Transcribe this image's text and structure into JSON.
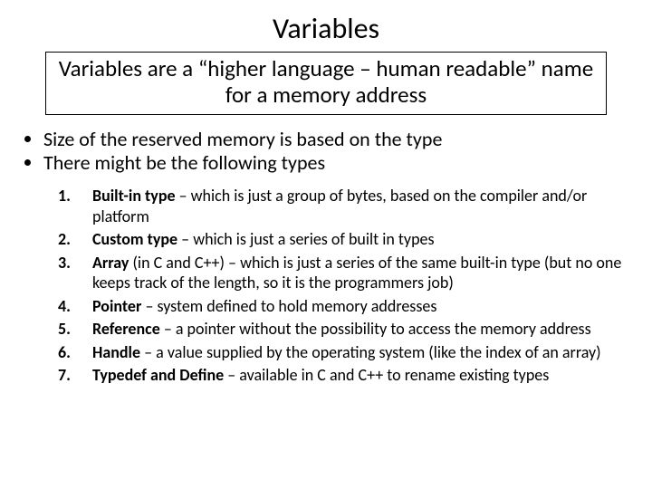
{
  "title": "Variables",
  "subtitle": "Variables are a “higher language – human readable” name for a memory address",
  "bullets": [
    "Size of the reserved memory is based on the type",
    "There might be the following types"
  ],
  "items": [
    {
      "num": "1.",
      "bold": "Built-in type",
      "rest": " – which is just a group of bytes, based on the compiler and/or platform"
    },
    {
      "num": "2.",
      "bold": "Custom type",
      "rest": " – which is just a series of built in types"
    },
    {
      "num": "3.",
      "bold": "Array",
      "rest": " (in C and C++) – which is just a series of the same built-in type (but no one keeps track of the length, so it is the programmers job)"
    },
    {
      "num": "4.",
      "bold": "Pointer",
      "rest": " – system defined to hold memory addresses"
    },
    {
      "num": "5.",
      "bold": "Reference",
      "rest": " – a pointer without the possibility to access the memory address"
    },
    {
      "num": "6.",
      "bold": "Handle",
      "rest": " – a value supplied by the operating system (like the index of an array)"
    },
    {
      "num": "7.",
      "bold": "Typedef and Define",
      "rest": " – available in C and C++ to rename existing types"
    }
  ]
}
